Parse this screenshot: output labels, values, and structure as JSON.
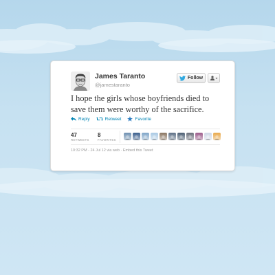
{
  "tweet": {
    "author_name": "James Taranto",
    "author_handle": "@jamestaranto",
    "text": "I hope the girls whose boyfriends died to save them were worthy of the sacrifice.",
    "follow_label": "Follow",
    "actions": {
      "reply_label": "Reply",
      "retweet_label": "Retweet",
      "favorite_label": "Favorite"
    },
    "stats": {
      "retweets_count": "47",
      "retweets_label": "RETWEETS",
      "favorites_count": "8",
      "favorites_label": "FAVORITES"
    },
    "meta": {
      "time": "10:32 PM",
      "date": "24 Jul 12",
      "via": "via web",
      "embed_label": "Embed this Tweet"
    }
  },
  "icons": {
    "follow": "bird-icon",
    "more": "user-dropdown-icon",
    "reply": "reply-icon",
    "retweet": "retweet-icon",
    "favorite": "star-icon"
  },
  "colors": {
    "background": "#c6e1f1",
    "link": "#0084b4",
    "twitter_blue": "#2fa8e0",
    "favorite_star": "#2a7ac0"
  },
  "favoriters": [
    {
      "color": "#6d8fb0"
    },
    {
      "color": "#3a5e8c"
    },
    {
      "color": "#7fa5c8"
    },
    {
      "color": "#a9c9e4"
    },
    {
      "color": "#8a7560"
    },
    {
      "color": "#5d7086"
    },
    {
      "color": "#4b5d72"
    },
    {
      "color": "#6a6f7a"
    },
    {
      "color": "#9b5a8a"
    },
    {
      "color": "#cfd8e6"
    },
    {
      "color": "#e8a84a"
    }
  ]
}
